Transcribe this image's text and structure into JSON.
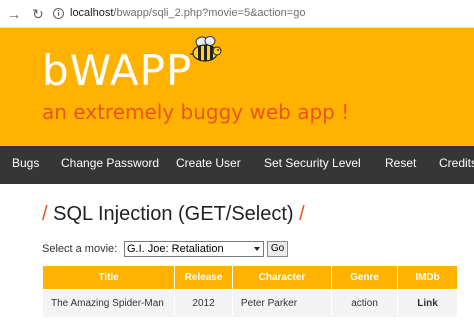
{
  "browser": {
    "url_host": "localhost",
    "url_path": "/bwapp/sqli_2.php?movie=5&action=go"
  },
  "header": {
    "logo": "bWAPP",
    "tagline": "an extremely buggy web app !"
  },
  "menu": {
    "items": [
      "Bugs",
      "Change Password",
      "Create User",
      "Set Security Level",
      "Reset",
      "Credits"
    ]
  },
  "main": {
    "slash_left": "/",
    "title": "SQL Injection (GET/Select)",
    "slash_right": "/",
    "select_label": "Select a movie:",
    "selected_movie": "G.I. Joe: Retaliation",
    "go_label": "Go"
  },
  "table": {
    "headers": [
      "Title",
      "Release",
      "Character",
      "Genre",
      "IMDb"
    ],
    "rows": [
      [
        "The Amazing Spider-Man",
        "2012",
        "Peter Parker",
        "action",
        "Link"
      ]
    ]
  },
  "colors": {
    "brand": "#ffb300",
    "accent": "#e8561b",
    "menu_bg": "#363636"
  }
}
